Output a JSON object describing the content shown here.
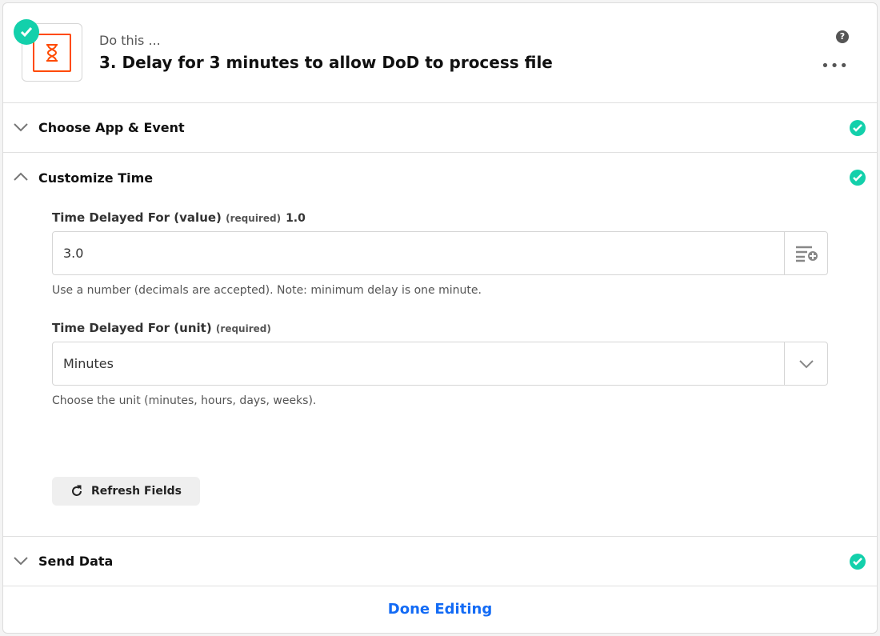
{
  "header": {
    "subtitle": "Do this ...",
    "title": "3. Delay for 3 minutes to allow DoD to process file",
    "help_icon": "?",
    "more_icon": "•••"
  },
  "sections": {
    "choose": "Choose App & Event",
    "customize": "Customize Time",
    "send": "Send Data"
  },
  "fields": {
    "value": {
      "label": "Time Delayed For (value)",
      "required": "(required)",
      "version": "1.0",
      "value": "3.0",
      "hint": "Use a number (decimals are accepted). Note: minimum delay is one minute."
    },
    "unit": {
      "label": "Time Delayed For (unit)",
      "required": "(required)",
      "value": "Minutes",
      "hint": "Choose the unit (minutes, hours, days, weeks)."
    }
  },
  "refresh_label": "Refresh Fields",
  "done_label": "Done Editing",
  "colors": {
    "accent": "#13d0ab",
    "link": "#136bf5",
    "brand": "#ff4a00"
  }
}
